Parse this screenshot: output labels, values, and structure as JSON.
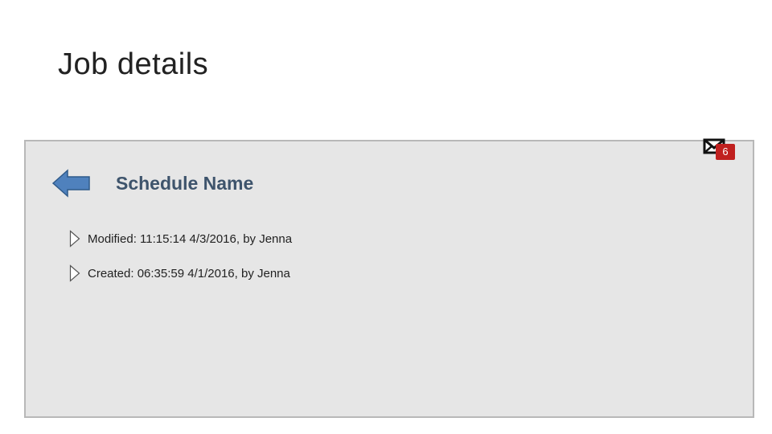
{
  "page": {
    "title": "Job details"
  },
  "notifications": {
    "icon": "mail-icon",
    "count": "6",
    "badge_color": "#c0201f"
  },
  "header": {
    "back_icon": "arrow-left-icon",
    "back_icon_color": "#4f81bd",
    "schedule_name": "Schedule Name"
  },
  "details": {
    "modified": "Modified: 11:15:14 4/3/2016, by Jenna",
    "created": "Created: 06:35:59 4/1/2016, by Jenna",
    "row_icon": "expand-triangle-icon"
  },
  "colors": {
    "panel_background": "#e6e6e6",
    "panel_border": "#b8b8b8",
    "schedule_name_text": "#3e546c"
  }
}
